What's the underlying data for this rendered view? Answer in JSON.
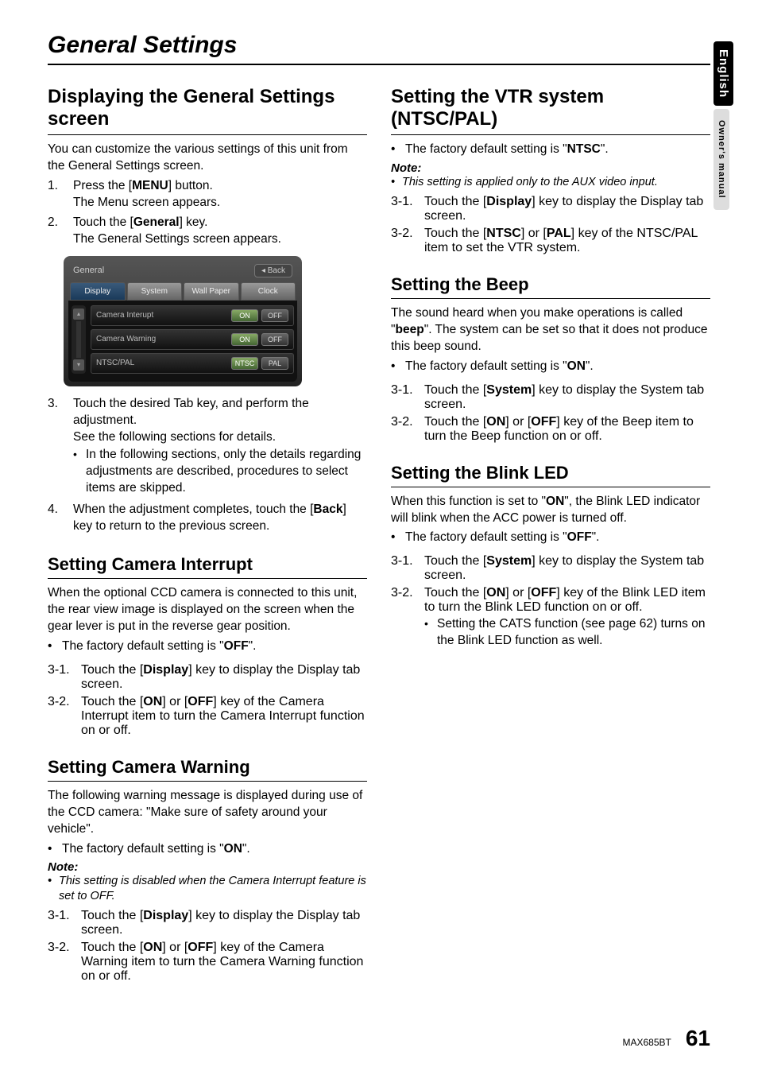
{
  "side_tabs": {
    "lang": "English",
    "manual": "Owner's manual"
  },
  "page_title": "General Settings",
  "left": {
    "sec1": {
      "heading": "Displaying the General Settings screen",
      "intro": "You can customize the various settings of this unit from the General Settings screen.",
      "steps": {
        "s1n": "1.",
        "s1a": "Press the [",
        "s1b": "MENU",
        "s1c": "] button.",
        "s1d": "The Menu screen appears.",
        "s2n": "2.",
        "s2a": "Touch the [",
        "s2b": "General",
        "s2c": "] key.",
        "s2d": "The General Settings screen appears.",
        "s3n": "3.",
        "s3a": "Touch the desired Tab key, and perform the adjustment.",
        "s3b": "See the following sections for details.",
        "s3bul": "In the following sections, only the details regarding adjustments are described, procedures to select items are skipped.",
        "s4n": "4.",
        "s4a": "When the adjustment completes, touch the [",
        "s4b": "Back",
        "s4c": "] key to return to the previous screen."
      },
      "shot": {
        "title": "General",
        "back": "◂ Back",
        "tabs": [
          "Display",
          "System",
          "Wall Paper",
          "Clock"
        ],
        "rows": [
          {
            "label": "Camera Interupt",
            "b1": "ON",
            "b2": "OFF",
            "sel": 0
          },
          {
            "label": "Camera Warning",
            "b1": "ON",
            "b2": "OFF",
            "sel": 0
          },
          {
            "label": "NTSC/PAL",
            "b1": "NTSC",
            "b2": "PAL",
            "sel": 0
          }
        ]
      }
    },
    "sec2": {
      "heading": "Setting Camera Interrupt",
      "p1": "When the optional CCD camera is connected to this unit, the rear view image is displayed on the screen when the gear lever is put in the reverse gear position.",
      "bul_a": "The factory default setting is \"",
      "bul_b": "OFF",
      "bul_c": "\".",
      "st31n": "3-1.",
      "st31a": "Touch the [",
      "st31b": "Display",
      "st31c": "] key to display the Display tab screen.",
      "st32n": "3-2.",
      "st32a": "Touch the [",
      "st32b": "ON",
      "st32c": "] or [",
      "st32d": "OFF",
      "st32e": "] key of the Camera Interrupt item to turn the Camera Interrupt function on or off."
    },
    "sec3": {
      "heading": "Setting Camera Warning",
      "p1": "The following warning message is displayed during use of the CCD camera: \"Make sure of safety around your vehicle\".",
      "bul_a": "The factory default setting is \"",
      "bul_b": "ON",
      "bul_c": "\".",
      "note_hd": "Note:",
      "note1": "This setting is disabled when the Camera Interrupt feature is set to OFF.",
      "st31n": "3-1.",
      "st31a": "Touch the [",
      "st31b": "Display",
      "st31c": "] key to display the Display tab screen.",
      "st32n": "3-2.",
      "st32a": "Touch the [",
      "st32b": "ON",
      "st32c": "] or [",
      "st32d": "OFF",
      "st32e": "] key of the Camera Warning item to turn the Camera Warning function on or off."
    }
  },
  "right": {
    "sec1": {
      "heading": "Setting the VTR system (NTSC/PAL)",
      "bul_a": "The factory default setting is \"",
      "bul_b": "NTSC",
      "bul_c": "\".",
      "note_hd": "Note:",
      "note1": "This setting is applied only to the AUX video input.",
      "st31n": "3-1.",
      "st31a": "Touch the [",
      "st31b": "Display",
      "st31c": "] key to display the Display tab screen.",
      "st32n": "3-2.",
      "st32a": "Touch the [",
      "st32b": "NTSC",
      "st32c": "] or [",
      "st32d": "PAL",
      "st32e": "] key of the NTSC/PAL item to set the VTR system."
    },
    "sec2": {
      "heading": "Setting the Beep",
      "p1a": "The sound heard when you make operations is called \"",
      "p1b": "beep",
      "p1c": "\". The system can be set so that it does not produce this beep sound.",
      "bul_a": "The factory default setting is \"",
      "bul_b": "ON",
      "bul_c": "\".",
      "st31n": "3-1.",
      "st31a": "Touch the [",
      "st31b": "System",
      "st31c": "] key to display the System tab screen.",
      "st32n": "3-2.",
      "st32a": "Touch the [",
      "st32b": "ON",
      "st32c": "] or [",
      "st32d": "OFF",
      "st32e": "] key of the Beep item to turn the Beep function on or off."
    },
    "sec3": {
      "heading": "Setting the Blink LED",
      "p1a": "When this function is set to \"",
      "p1b": "ON",
      "p1c": "\", the Blink LED indicator will blink when the ACC power is turned off.",
      "bul_a": "The factory default setting is \"",
      "bul_b": "OFF",
      "bul_c": "\".",
      "st31n": "3-1.",
      "st31a": "Touch the [",
      "st31b": "System",
      "st31c": "] key to display the System tab screen.",
      "st32n": "3-2.",
      "st32a": "Touch the [",
      "st32b": "ON",
      "st32c": "] or [",
      "st32d": "OFF",
      "st32e": "] key of the Blink LED item to turn the Blink LED function on or off.",
      "sub1": "Setting the CATS function (see page 62) turns on the Blink LED function as well."
    }
  },
  "footer": {
    "model": "MAX685BT",
    "page": "61"
  }
}
